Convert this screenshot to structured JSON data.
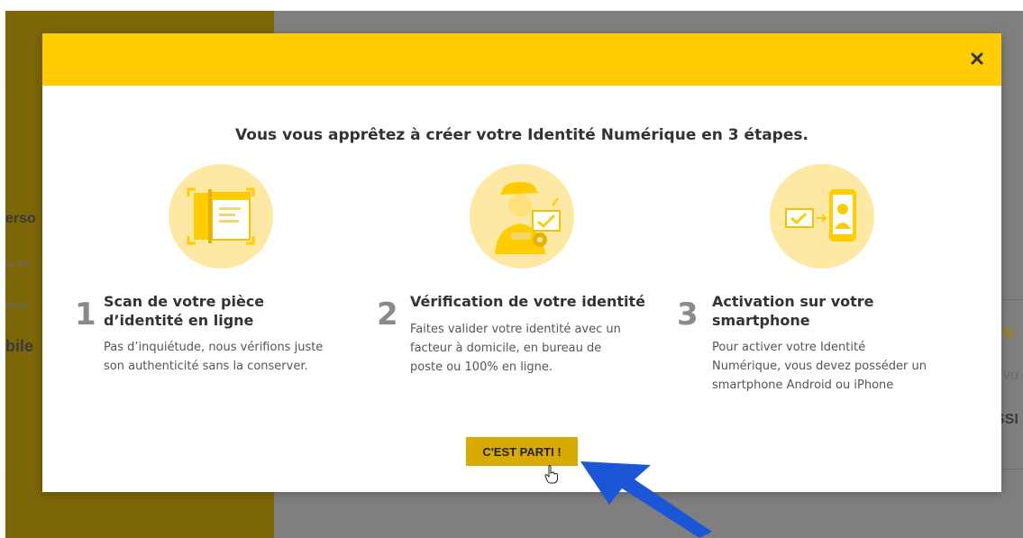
{
  "background": {
    "fragments": [
      "erso",
      "ce d'id",
      "ations",
      "bile",
      "VE",
      "t vo",
      "SSI"
    ]
  },
  "modal": {
    "close_label": "×",
    "title": "Vous vous apprêtez à créer votre Identité Numérique en 3 étapes.",
    "steps": [
      {
        "number": "1",
        "title_line1": "Scan de votre pièce",
        "title_line2": "d’identité en ligne",
        "desc_line1": "Pas d’inquiétude, nous vérifions juste",
        "desc_line2": "son authenticité sans la conserver.",
        "icon": "id-scan-icon"
      },
      {
        "number": "2",
        "title_line1": "Vérification de votre identité",
        "desc_line1": "Faites valider votre identité avec un",
        "desc_line2": "facteur à domicile, en bureau de",
        "desc_line3": "poste ou 100% en ligne.",
        "icon": "postman-icon"
      },
      {
        "number": "3",
        "title_line1": "Activation sur votre",
        "title_line2": "smartphone",
        "desc_line1": "Pour activer votre Identité",
        "desc_line2": "Numérique, vous devez posséder un",
        "desc_line3": "smartphone Android ou iPhone",
        "icon": "smartphone-icon"
      }
    ],
    "cta_label": "C'EST PARTI !"
  },
  "colors": {
    "header": "#ffcc00",
    "button": "#d8ab00",
    "illustration_bg": "#fde9a4",
    "annotation_arrow": "#1a56d6"
  }
}
